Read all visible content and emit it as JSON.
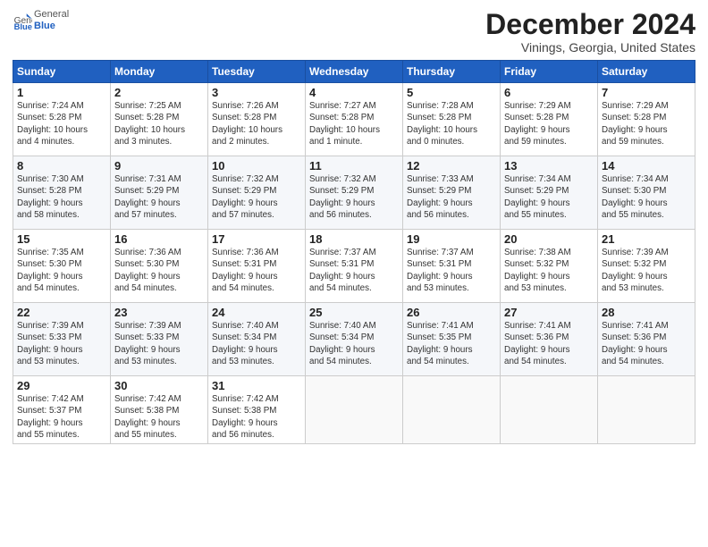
{
  "header": {
    "logo_line1": "General",
    "logo_line2": "Blue",
    "month_year": "December 2024",
    "location": "Vinings, Georgia, United States"
  },
  "days_of_week": [
    "Sunday",
    "Monday",
    "Tuesday",
    "Wednesday",
    "Thursday",
    "Friday",
    "Saturday"
  ],
  "weeks": [
    [
      {
        "day": 1,
        "info": "Sunrise: 7:24 AM\nSunset: 5:28 PM\nDaylight: 10 hours\nand 4 minutes."
      },
      {
        "day": 2,
        "info": "Sunrise: 7:25 AM\nSunset: 5:28 PM\nDaylight: 10 hours\nand 3 minutes."
      },
      {
        "day": 3,
        "info": "Sunrise: 7:26 AM\nSunset: 5:28 PM\nDaylight: 10 hours\nand 2 minutes."
      },
      {
        "day": 4,
        "info": "Sunrise: 7:27 AM\nSunset: 5:28 PM\nDaylight: 10 hours\nand 1 minute."
      },
      {
        "day": 5,
        "info": "Sunrise: 7:28 AM\nSunset: 5:28 PM\nDaylight: 10 hours\nand 0 minutes."
      },
      {
        "day": 6,
        "info": "Sunrise: 7:29 AM\nSunset: 5:28 PM\nDaylight: 9 hours\nand 59 minutes."
      },
      {
        "day": 7,
        "info": "Sunrise: 7:29 AM\nSunset: 5:28 PM\nDaylight: 9 hours\nand 59 minutes."
      }
    ],
    [
      {
        "day": 8,
        "info": "Sunrise: 7:30 AM\nSunset: 5:28 PM\nDaylight: 9 hours\nand 58 minutes."
      },
      {
        "day": 9,
        "info": "Sunrise: 7:31 AM\nSunset: 5:29 PM\nDaylight: 9 hours\nand 57 minutes."
      },
      {
        "day": 10,
        "info": "Sunrise: 7:32 AM\nSunset: 5:29 PM\nDaylight: 9 hours\nand 57 minutes."
      },
      {
        "day": 11,
        "info": "Sunrise: 7:32 AM\nSunset: 5:29 PM\nDaylight: 9 hours\nand 56 minutes."
      },
      {
        "day": 12,
        "info": "Sunrise: 7:33 AM\nSunset: 5:29 PM\nDaylight: 9 hours\nand 56 minutes."
      },
      {
        "day": 13,
        "info": "Sunrise: 7:34 AM\nSunset: 5:29 PM\nDaylight: 9 hours\nand 55 minutes."
      },
      {
        "day": 14,
        "info": "Sunrise: 7:34 AM\nSunset: 5:30 PM\nDaylight: 9 hours\nand 55 minutes."
      }
    ],
    [
      {
        "day": 15,
        "info": "Sunrise: 7:35 AM\nSunset: 5:30 PM\nDaylight: 9 hours\nand 54 minutes."
      },
      {
        "day": 16,
        "info": "Sunrise: 7:36 AM\nSunset: 5:30 PM\nDaylight: 9 hours\nand 54 minutes."
      },
      {
        "day": 17,
        "info": "Sunrise: 7:36 AM\nSunset: 5:31 PM\nDaylight: 9 hours\nand 54 minutes."
      },
      {
        "day": 18,
        "info": "Sunrise: 7:37 AM\nSunset: 5:31 PM\nDaylight: 9 hours\nand 54 minutes."
      },
      {
        "day": 19,
        "info": "Sunrise: 7:37 AM\nSunset: 5:31 PM\nDaylight: 9 hours\nand 53 minutes."
      },
      {
        "day": 20,
        "info": "Sunrise: 7:38 AM\nSunset: 5:32 PM\nDaylight: 9 hours\nand 53 minutes."
      },
      {
        "day": 21,
        "info": "Sunrise: 7:39 AM\nSunset: 5:32 PM\nDaylight: 9 hours\nand 53 minutes."
      }
    ],
    [
      {
        "day": 22,
        "info": "Sunrise: 7:39 AM\nSunset: 5:33 PM\nDaylight: 9 hours\nand 53 minutes."
      },
      {
        "day": 23,
        "info": "Sunrise: 7:39 AM\nSunset: 5:33 PM\nDaylight: 9 hours\nand 53 minutes."
      },
      {
        "day": 24,
        "info": "Sunrise: 7:40 AM\nSunset: 5:34 PM\nDaylight: 9 hours\nand 53 minutes."
      },
      {
        "day": 25,
        "info": "Sunrise: 7:40 AM\nSunset: 5:34 PM\nDaylight: 9 hours\nand 54 minutes."
      },
      {
        "day": 26,
        "info": "Sunrise: 7:41 AM\nSunset: 5:35 PM\nDaylight: 9 hours\nand 54 minutes."
      },
      {
        "day": 27,
        "info": "Sunrise: 7:41 AM\nSunset: 5:36 PM\nDaylight: 9 hours\nand 54 minutes."
      },
      {
        "day": 28,
        "info": "Sunrise: 7:41 AM\nSunset: 5:36 PM\nDaylight: 9 hours\nand 54 minutes."
      }
    ],
    [
      {
        "day": 29,
        "info": "Sunrise: 7:42 AM\nSunset: 5:37 PM\nDaylight: 9 hours\nand 55 minutes."
      },
      {
        "day": 30,
        "info": "Sunrise: 7:42 AM\nSunset: 5:38 PM\nDaylight: 9 hours\nand 55 minutes."
      },
      {
        "day": 31,
        "info": "Sunrise: 7:42 AM\nSunset: 5:38 PM\nDaylight: 9 hours\nand 56 minutes."
      },
      null,
      null,
      null,
      null
    ]
  ]
}
